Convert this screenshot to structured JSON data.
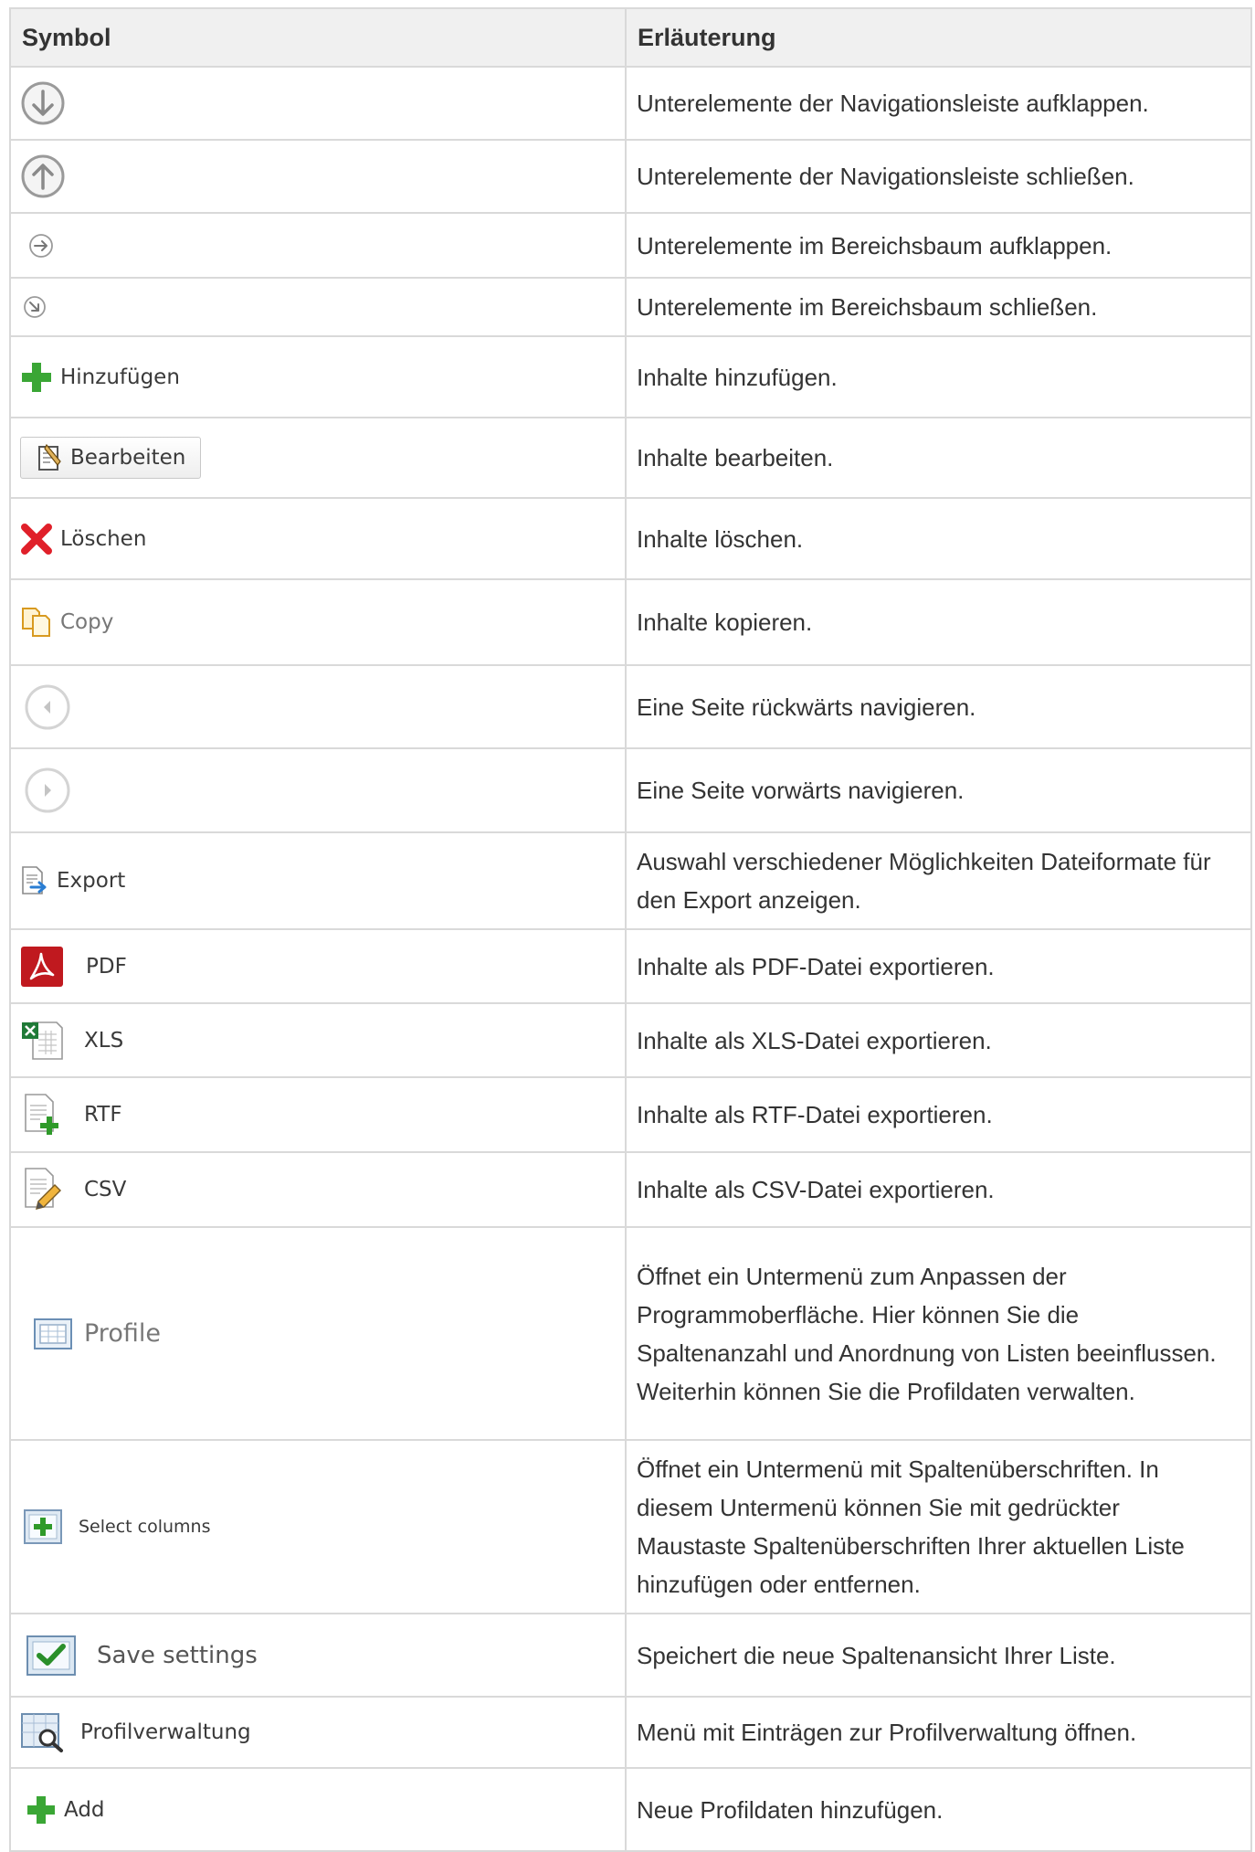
{
  "header": {
    "symbol": "Symbol",
    "explanation": "Erläuterung"
  },
  "rows": [
    {
      "icon": "circle-arrow-down-icon",
      "label": "",
      "desc": "Unterelemente der Navigationsleiste aufklappen."
    },
    {
      "icon": "circle-arrow-up-icon",
      "label": "",
      "desc": "Unterelemente der Navigationsleiste schließen."
    },
    {
      "icon": "circle-arrow-right-small-icon",
      "label": "",
      "desc": "Unterelemente im Bereichsbaum aufklappen."
    },
    {
      "icon": "circle-arrow-diagonal-small-icon",
      "label": "",
      "desc": "Unterelemente im Bereichsbaum schließen."
    },
    {
      "icon": "green-plus-icon",
      "label": "Hinzufügen",
      "desc": "Inhalte hinzufügen."
    },
    {
      "icon": "edit-document-icon",
      "label": "Bearbeiten",
      "desc": "Inhalte bearbeiten."
    },
    {
      "icon": "red-x-icon",
      "label": "Löschen",
      "desc": "Inhalte löschen."
    },
    {
      "icon": "copy-icon",
      "label": "Copy",
      "desc": "Inhalte kopieren."
    },
    {
      "icon": "circle-chevron-left-icon",
      "label": "",
      "desc": "Eine Seite rückwärts navigieren."
    },
    {
      "icon": "circle-chevron-right-icon",
      "label": "",
      "desc": "Eine Seite vorwärts navigieren."
    },
    {
      "icon": "export-icon",
      "label": "Export",
      "desc": "Auswahl verschiedener Möglichkeiten Dateiformate für den Export anzeigen."
    },
    {
      "icon": "pdf-icon",
      "label": "PDF",
      "desc": "Inhalte als PDF-Datei exportieren."
    },
    {
      "icon": "xls-icon",
      "label": "XLS",
      "desc": "Inhalte als XLS-Datei exportieren."
    },
    {
      "icon": "rtf-icon",
      "label": "RTF",
      "desc": "Inhalte als RTF-Datei exportieren."
    },
    {
      "icon": "csv-icon",
      "label": "CSV",
      "desc": "Inhalte als CSV-Datei exportieren."
    },
    {
      "icon": "profile-icon",
      "label": "Profile",
      "desc": "Öffnet ein Untermenü zum Anpassen der Programmoberfläche. Hier können Sie die Spaltenanzahl und Anordnung von Listen beeinflussen. Weiterhin können Sie die Profildaten verwalten."
    },
    {
      "icon": "select-columns-icon",
      "label": "Select columns",
      "desc": "Öffnet ein Untermenü mit Spaltenüberschriften. In diesem Untermenü können Sie mit gedrückter Maustaste Spaltenüberschriften Ihrer aktuellen Liste hinzufügen oder entfernen."
    },
    {
      "icon": "save-settings-icon",
      "label": "Save settings",
      "desc": "Speichert die neue Spaltenansicht Ihrer Liste."
    },
    {
      "icon": "profile-management-icon",
      "label": "Profilverwaltung",
      "desc": "Menü mit Einträgen zur Profilverwaltung öffnen."
    },
    {
      "icon": "green-plus-icon",
      "label": "Add",
      "desc": "Neue Profildaten hinzufügen."
    }
  ]
}
